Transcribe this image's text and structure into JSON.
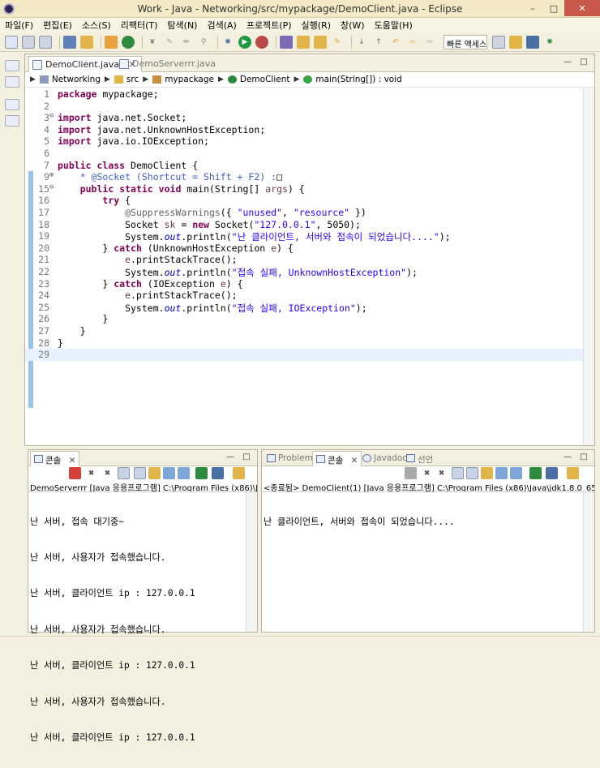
{
  "window": {
    "title": "Work - Java - Networking/src/mypackage/DemoClient.java - Eclipse"
  },
  "menu": [
    "파일(F)",
    "편집(E)",
    "소스(S)",
    "리팩터(T)",
    "탐색(N)",
    "검색(A)",
    "프로젝트(P)",
    "실행(R)",
    "창(W)",
    "도움말(H)"
  ],
  "toolbar": {
    "quick_access": "빠른 액세스"
  },
  "editor": {
    "tabs": [
      {
        "label": "DemoClient.java",
        "active": true
      },
      {
        "label": "DemoServerrr.java",
        "active": false
      }
    ],
    "breadcrumb": [
      "Networking",
      "src",
      "mypackage",
      "DemoClient",
      "main(String[]) : void"
    ],
    "lines": [
      {
        "n": "1"
      },
      {
        "n": "2"
      },
      {
        "n": "3"
      },
      {
        "n": "4"
      },
      {
        "n": "5"
      },
      {
        "n": "6"
      },
      {
        "n": "7"
      },
      {
        "n": "9"
      },
      {
        "n": "15"
      },
      {
        "n": "16"
      },
      {
        "n": "17"
      },
      {
        "n": "18"
      },
      {
        "n": "19"
      },
      {
        "n": "20"
      },
      {
        "n": "21"
      },
      {
        "n": "22"
      },
      {
        "n": "23"
      },
      {
        "n": "24"
      },
      {
        "n": "25"
      },
      {
        "n": "26"
      },
      {
        "n": "27"
      },
      {
        "n": "28"
      },
      {
        "n": "29"
      }
    ]
  },
  "console_left": {
    "tab": "콘솔",
    "label": "DemoServerrr [Java 응용프로그램] C:\\Program Files (x86)\\Java\\jd",
    "output": [
      "난 서버, 접속 대기중~",
      "난 서버, 사용자가 접속했습니다.",
      "난 서버, 클라이언트 ip : 127.0.0.1",
      "난 서버, 사용자가 접속했습니다.",
      "난 서버, 클라이언트 ip : 127.0.0.1",
      "난 서버, 사용자가 접속했습니다.",
      "난 서버, 클라이언트 ip : 127.0.0.1"
    ]
  },
  "console_right": {
    "tabs": [
      "Problems",
      "콘솔",
      "Javadoc",
      "선언"
    ],
    "label": "<종료됨> DemoClient(1) [Java 응용프로그램] C:\\Program Files (x86)\\Java\\jdk1.8.0_65\\bin\\jav",
    "output": [
      "난 클라이언트, 서버와 접속이 되었습니다...."
    ]
  },
  "colors": {
    "keyword": "#7f0055",
    "string": "#2a00ff",
    "annotation": "#646464",
    "static_field": "#0000c0",
    "javadoc": "#3f5fbf",
    "close_button": "#c7584a"
  }
}
